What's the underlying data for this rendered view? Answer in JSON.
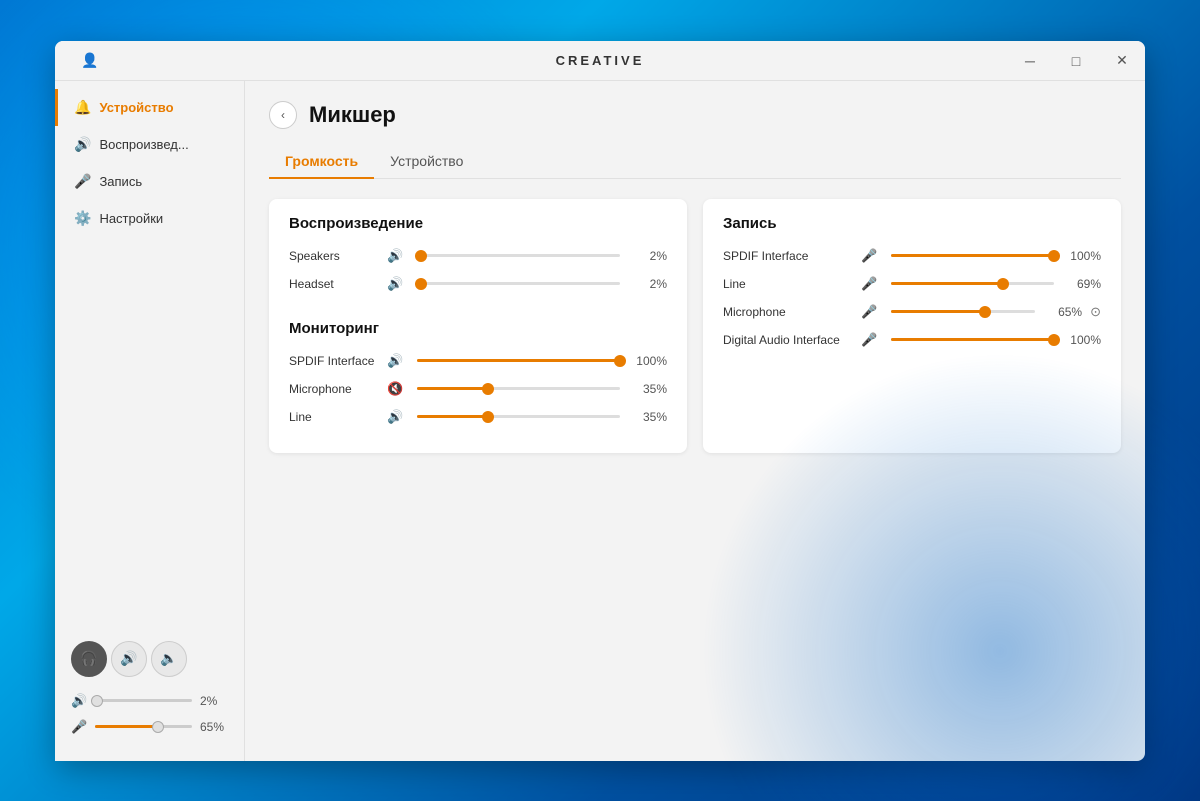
{
  "app": {
    "title": "CREATIVE",
    "brand_logo": "CREATIVE"
  },
  "titlebar": {
    "user_icon": "👤",
    "minimize_label": "─",
    "maximize_label": "□",
    "close_label": "✕"
  },
  "sidebar": {
    "items": [
      {
        "id": "device",
        "label": "Устройство",
        "icon": "🔔",
        "active": true
      },
      {
        "id": "playback",
        "label": "Воспроизвед...",
        "icon": "🔊",
        "active": false
      },
      {
        "id": "record",
        "label": "Запись",
        "icon": "🎤",
        "active": false
      },
      {
        "id": "settings",
        "label": "Настройки",
        "icon": "⚙️",
        "active": false
      }
    ],
    "device_icons": [
      {
        "id": "headphones",
        "icon": "🎧",
        "active": true
      },
      {
        "id": "audio1",
        "icon": "🔊",
        "active": false
      },
      {
        "id": "audio2",
        "icon": "🔈",
        "active": false
      }
    ],
    "volume_output": {
      "icon": "🔊",
      "value": "2%",
      "fill_percent": 2
    },
    "volume_mic": {
      "icon": "🎤",
      "value": "65%",
      "fill_percent": 65
    }
  },
  "page": {
    "title": "Микшер",
    "back_icon": "‹"
  },
  "tabs": [
    {
      "id": "volume",
      "label": "Громкость",
      "active": true
    },
    {
      "id": "device",
      "label": "Устройство",
      "active": false
    }
  ],
  "playback_section": {
    "title": "Воспроизведение",
    "rows": [
      {
        "label": "Speakers",
        "icon": "🔊",
        "fill_percent": 2,
        "value": "2%"
      },
      {
        "label": "Headset",
        "icon": "🔊",
        "fill_percent": 2,
        "value": "2%"
      }
    ]
  },
  "monitoring_section": {
    "title": "Мониторинг",
    "rows": [
      {
        "label": "SPDIF Interface",
        "icon": "🔊",
        "fill_percent": 100,
        "value": "100%"
      },
      {
        "label": "Microphone",
        "icon": "🔇",
        "fill_percent": 35,
        "value": "35%"
      },
      {
        "label": "Line",
        "icon": "🔊",
        "fill_percent": 35,
        "value": "35%"
      }
    ]
  },
  "recording_section": {
    "title": "Запись",
    "rows": [
      {
        "label": "SPDIF Interface",
        "icon": "🎤",
        "fill_percent": 100,
        "value": "100%",
        "has_extra": false
      },
      {
        "label": "Line",
        "icon": "🎤",
        "fill_percent": 69,
        "value": "69%",
        "has_extra": false
      },
      {
        "label": "Microphone",
        "icon": "🎤",
        "fill_percent": 65,
        "value": "65%",
        "has_extra": true
      },
      {
        "label": "Digital Audio Interface",
        "icon": "🎤",
        "fill_percent": 100,
        "value": "100%",
        "has_extra": false
      }
    ]
  }
}
